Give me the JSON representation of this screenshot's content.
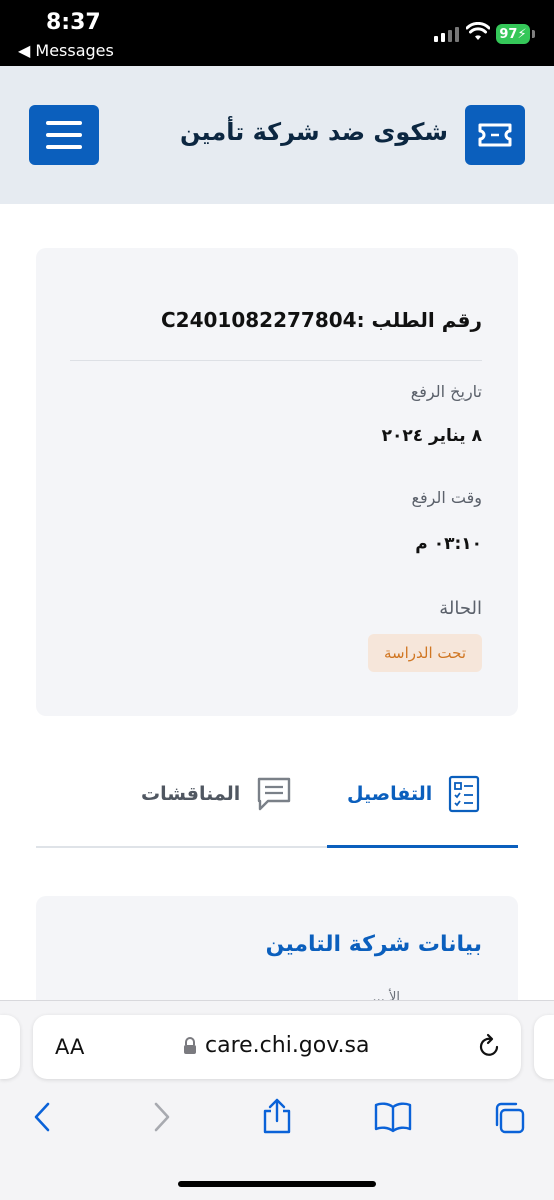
{
  "status_bar": {
    "time": "8:37",
    "back_label": "◀ Messages",
    "battery": "97"
  },
  "header": {
    "title": "شكوى ضد شركة تأمين",
    "menu_icon": "hamburger-menu-icon",
    "ticket_icon": "ticket-icon"
  },
  "request": {
    "number_line": "رقم الطلب :C2401082277804",
    "upload_date_label": "تاريخ الرفع",
    "upload_date": "٨ يناير ٢٠٢٤",
    "upload_time_label": "وقت الرفع",
    "upload_time": "٠٣:١٠ م",
    "status_label": "الحالة",
    "status": "تحت الدراسة",
    "status_color": "#d07622"
  },
  "tabs": [
    {
      "label": "التفاصيل",
      "icon": "details-document-icon",
      "active": true
    },
    {
      "label": "المناقشات",
      "icon": "chat-bubble-icon",
      "active": false
    }
  ],
  "section": {
    "title": "بيانات شركة التامين",
    "partial_label": "... الأ"
  },
  "browser": {
    "aa_label": "AA",
    "url": "care.chi.gov.sa"
  },
  "colors": {
    "primary": "#0b5fbd",
    "header_bg": "#e6ebf1",
    "card_bg": "#f4f5f8"
  }
}
